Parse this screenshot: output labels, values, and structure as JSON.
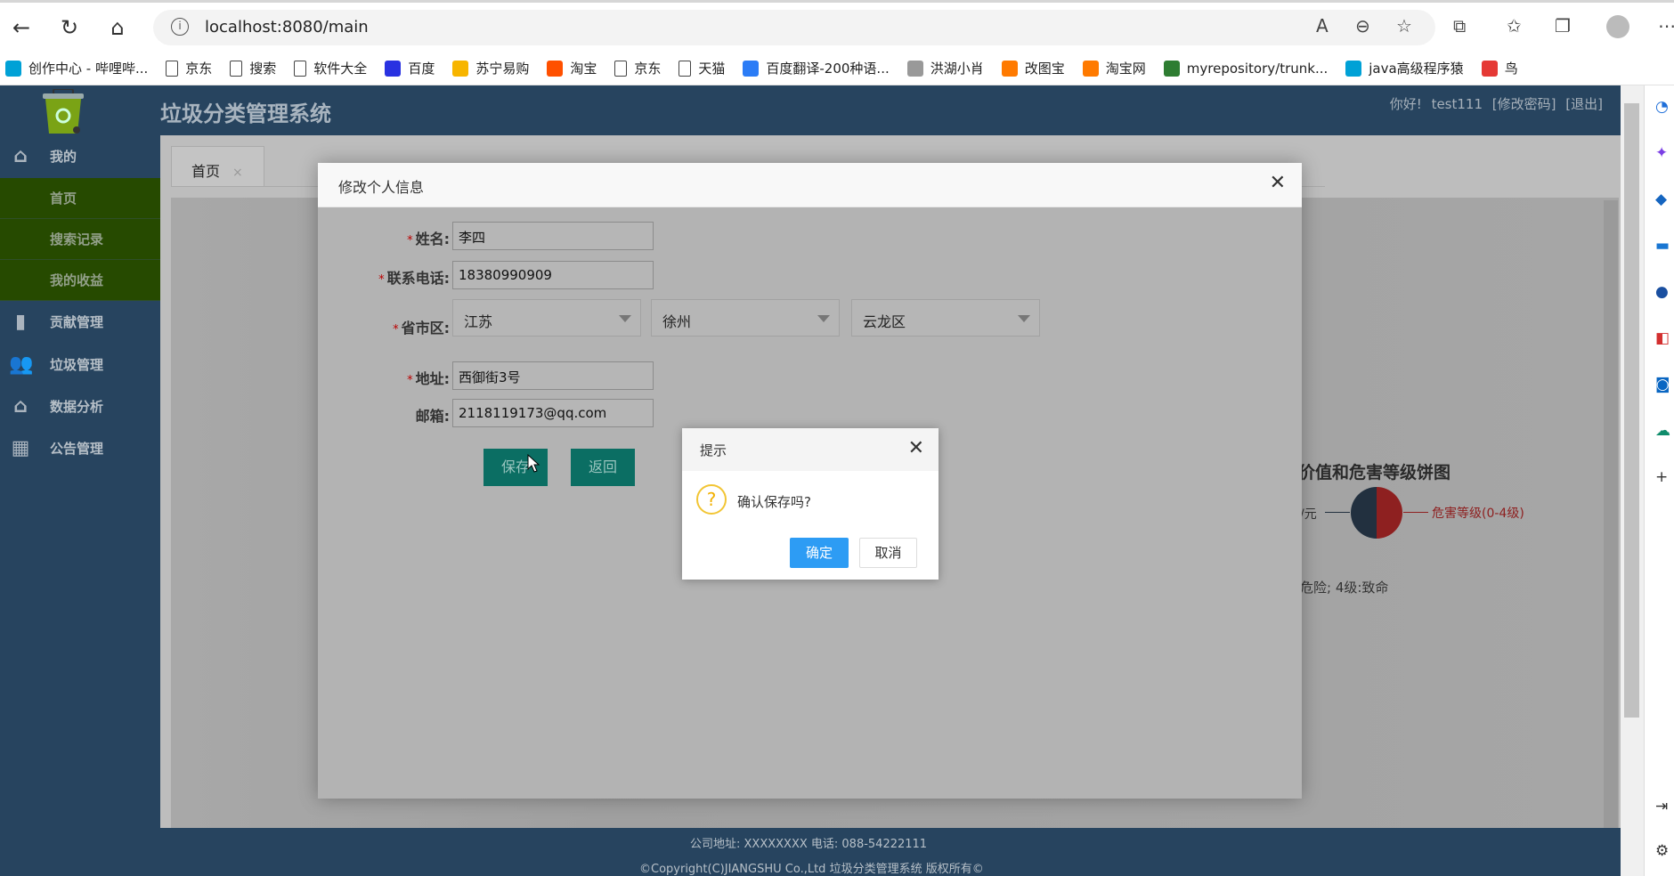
{
  "browser": {
    "url": "localhost:8080/main",
    "bookmarks": [
      {
        "label": "创作中心 - 哔哩哔...",
        "icon": "bilibili-icon",
        "color": "#00a1d6"
      },
      {
        "label": "京东",
        "icon": "page-icon",
        "color": ""
      },
      {
        "label": "搜索",
        "icon": "page-icon",
        "color": ""
      },
      {
        "label": "软件大全",
        "icon": "page-icon",
        "color": ""
      },
      {
        "label": "百度",
        "icon": "baidu-icon",
        "color": "#2932e1"
      },
      {
        "label": "苏宁易购",
        "icon": "suning-icon",
        "color": "#f7b500"
      },
      {
        "label": "淘宝",
        "icon": "taobao-icon",
        "color": "#ff5000"
      },
      {
        "label": "京东",
        "icon": "page-icon",
        "color": ""
      },
      {
        "label": "天猫",
        "icon": "page-icon",
        "color": ""
      },
      {
        "label": "百度翻译-200种语...",
        "icon": "translate-icon",
        "color": "#2b7cf6"
      },
      {
        "label": "洪湖小肖",
        "icon": "avatar-icon",
        "color": "#999"
      },
      {
        "label": "改图宝",
        "icon": "gaitubao-icon",
        "color": "#ff7a00"
      },
      {
        "label": "淘宝网",
        "icon": "taobao-icon",
        "color": "#ff7a00"
      },
      {
        "label": "myrepository/trunk...",
        "icon": "repo-icon",
        "color": "#2e7d32"
      },
      {
        "label": "java高级程序猿",
        "icon": "bilibili-icon",
        "color": "#00a1d6"
      },
      {
        "label": "鸟",
        "icon": "bird-icon",
        "color": "#e53935"
      }
    ]
  },
  "app": {
    "title": "垃圾分类管理系统",
    "greeting": "你好!",
    "username": "test111",
    "change_password": "[修改密码]",
    "logout": "[退出]"
  },
  "sidebar": {
    "groups": [
      {
        "label": "我的",
        "icon": "home-icon"
      },
      {
        "label": "贡献管理",
        "icon": "bar-chart-icon"
      },
      {
        "label": "垃圾管理",
        "icon": "users-icon"
      },
      {
        "label": "数据分析",
        "icon": "house-check-icon"
      },
      {
        "label": "公告管理",
        "icon": "grid-icon"
      }
    ],
    "subitems": [
      {
        "label": "首页"
      },
      {
        "label": "搜索记录"
      },
      {
        "label": "我的收益"
      }
    ]
  },
  "tabs": [
    {
      "label": "首页",
      "close": "×"
    }
  ],
  "background_chart": {
    "title_fragment": "价值和危害等级饼图",
    "left_label_fragment": "/元",
    "right_label": "危害等级(0-4级)",
    "note_fragment": "危险; 4级:致命",
    "colors": [
      "#22303f",
      "#8e2020"
    ]
  },
  "edit_dialog": {
    "title": "修改个人信息",
    "close": "✕",
    "fields": {
      "name": {
        "label": "姓名:",
        "value": "李四",
        "required": true
      },
      "phone": {
        "label": "联系电话:",
        "value": "18380990909",
        "required": true
      },
      "region": {
        "label": "省市区:",
        "province": "江苏",
        "city": "徐州",
        "district": "云龙区",
        "required": true
      },
      "address": {
        "label": "地址:",
        "value": "西御街3号",
        "required": true
      },
      "email": {
        "label": "邮箱:",
        "value": "2118119173@qq.com",
        "required": false
      }
    },
    "required_mark": "*",
    "save": "保存",
    "back": "返回"
  },
  "confirm_dialog": {
    "title": "提示",
    "close": "✕",
    "icon": "question-icon",
    "message": "确认保存吗?",
    "ok": "确定",
    "cancel": "取消"
  },
  "footer": {
    "line1": "公司地址: XXXXXXXX 电话: 088-54222111",
    "line2": "©Copyright(C)JIANGSHU Co.,Ltd 垃圾分类管理系统 版权所有©"
  }
}
